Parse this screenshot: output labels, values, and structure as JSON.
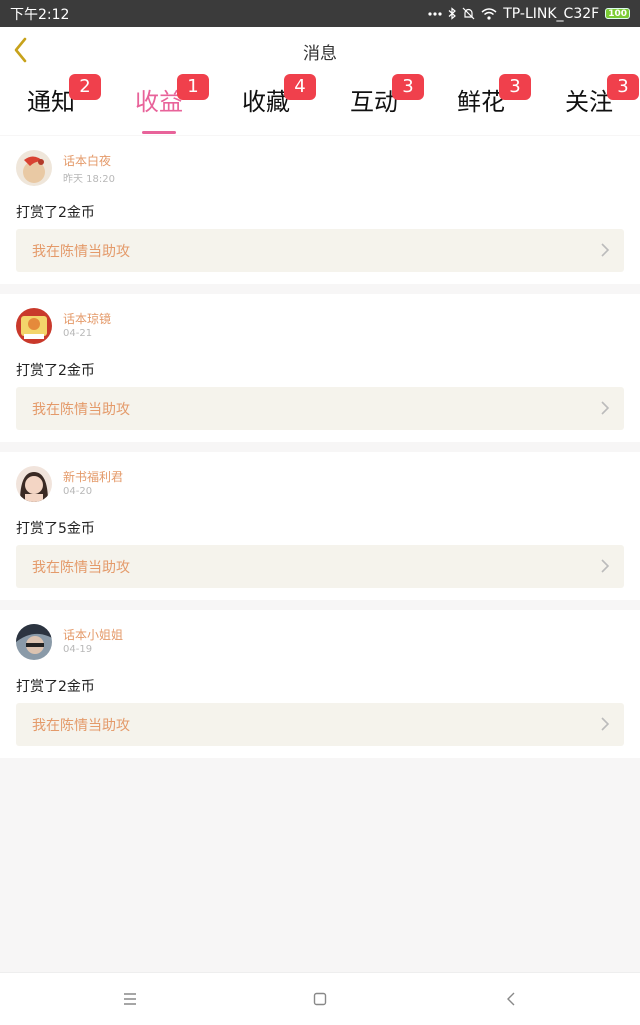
{
  "status_bar": {
    "time": "下午2:12",
    "wifi_name": "TP-LINK_C32F",
    "battery": "100",
    "icons": [
      "more-dots-icon",
      "bluetooth-icon",
      "silent-bell-icon",
      "wifi-icon",
      "battery-icon"
    ]
  },
  "header": {
    "title": "消息"
  },
  "tabs": [
    {
      "label": "通知",
      "badge": "2"
    },
    {
      "label": "收益",
      "badge": "1",
      "active": true
    },
    {
      "label": "收藏",
      "badge": "4"
    },
    {
      "label": "互动",
      "badge": "3"
    },
    {
      "label": "鲜花",
      "badge": "3"
    },
    {
      "label": "关注",
      "badge": "3"
    }
  ],
  "messages": [
    {
      "user": "话本白夜",
      "time": "昨天 18:20",
      "text": "打赏了2金币",
      "book": "我在陈情当助攻"
    },
    {
      "user": "话本琼镜",
      "time": "04-21",
      "text": "打赏了2金币",
      "book": "我在陈情当助攻"
    },
    {
      "user": "新书福利君",
      "time": "04-20",
      "text": "打赏了5金币",
      "book": "我在陈情当助攻"
    },
    {
      "user": "话本小姐姐",
      "time": "04-19",
      "text": "打赏了2金币",
      "book": "我在陈情当助攻"
    }
  ],
  "colors": {
    "accent": "#e8639a",
    "badge": "#f0404c",
    "username": "#e49a6a",
    "link_bg": "#f5f3ec"
  },
  "nav_icons": [
    "menu-icon",
    "home-icon",
    "back-nav-icon"
  ]
}
